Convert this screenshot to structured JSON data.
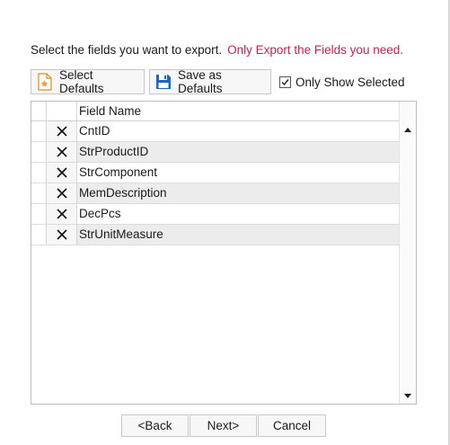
{
  "instructions": {
    "text": "Select the fields you want to export.",
    "hint": "Only Export the Fields you need."
  },
  "toolbar": {
    "select_defaults_label": "Select Defaults",
    "save_defaults_label": "Save as Defaults",
    "only_show_selected_label": "Only Show Selected",
    "only_show_selected_checked": true
  },
  "grid": {
    "column_header": "Field Name",
    "rows": [
      {
        "name": "CntID"
      },
      {
        "name": "StrProductID"
      },
      {
        "name": "StrComponent"
      },
      {
        "name": "MemDescription"
      },
      {
        "name": "DecPcs"
      },
      {
        "name": "StrUnitMeasure"
      }
    ]
  },
  "nav": {
    "back_label": "<Back",
    "next_label": "Next>",
    "cancel_label": "Cancel"
  },
  "colors": {
    "hint": "#d11f48",
    "save_icon": "#1e63c8",
    "defaults_icon": "#f0a030"
  },
  "icons": {
    "select_defaults": "document-star-icon",
    "save_defaults": "floppy-disk-icon",
    "row_remove": "close-icon"
  }
}
